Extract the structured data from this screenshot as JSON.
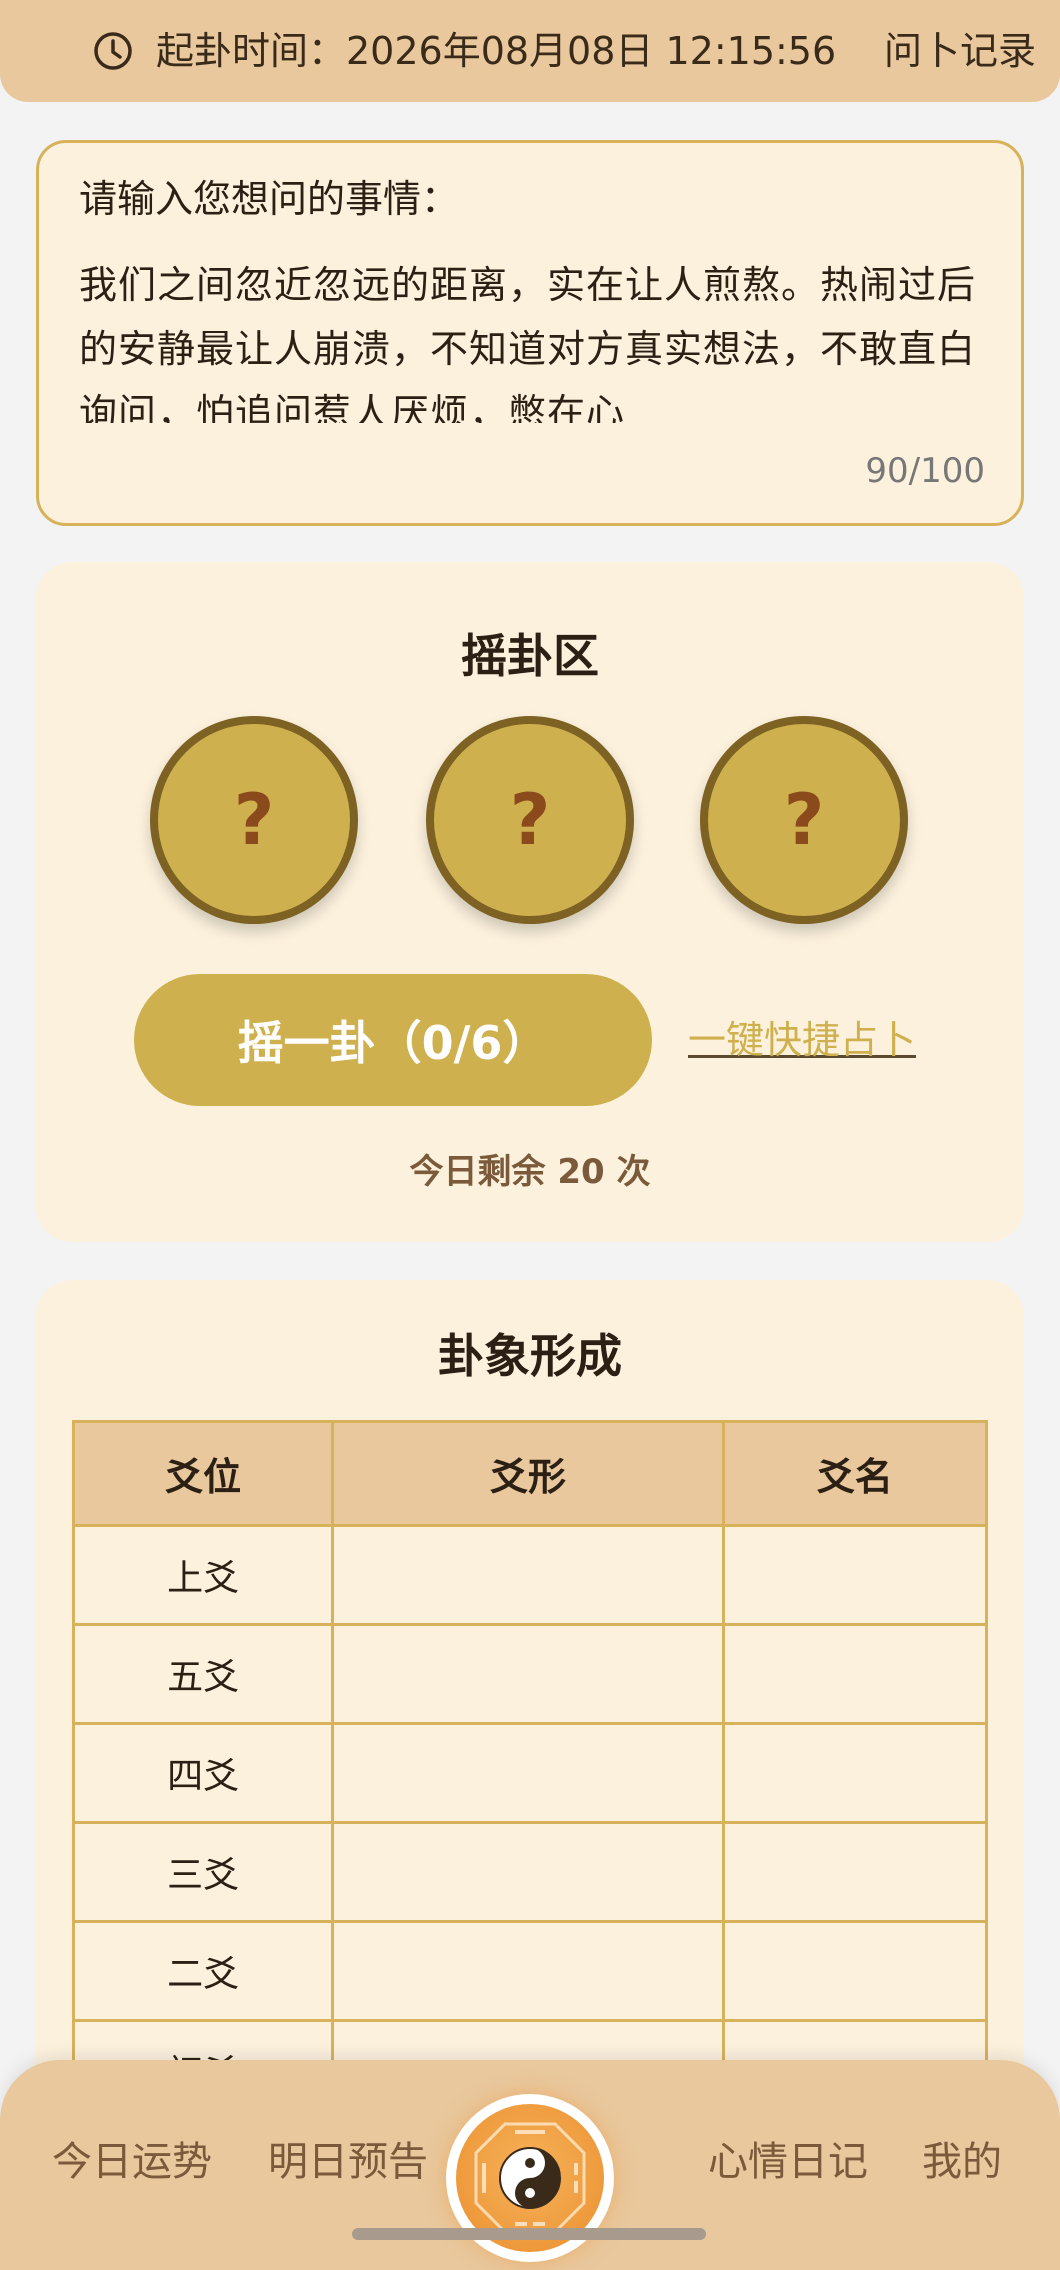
{
  "header": {
    "start_time": "起卦时间：2026年08月08日 12:15:56",
    "records": "问卜记录"
  },
  "question": {
    "label": "请输入您想问的事情：",
    "text": "我们之间忽近忽远的距离，实在让人煎熬。热闹过后的安静最让人崩溃，不知道对方真实想法，不敢直白询问，怕追问惹人厌烦，憋在心",
    "count": "90/100"
  },
  "shake": {
    "title": "摇卦区",
    "coins": [
      "?",
      "?",
      "?"
    ],
    "button": "摇一卦（0/6）",
    "quick": "一键快捷占卜",
    "remaining": "今日剩余 20 次"
  },
  "hexagram": {
    "title": "卦象形成",
    "headers": [
      "爻位",
      "爻形",
      "爻名"
    ],
    "rows": [
      "上爻",
      "五爻",
      "四爻",
      "三爻",
      "二爻",
      "初爻"
    ]
  },
  "nav": {
    "items": [
      "今日运势",
      "明日预告",
      "心情日记",
      "我的"
    ]
  },
  "colors": {
    "header_bg": "#e9c89d",
    "card_bg": "#fcf1dd",
    "gold": "#cfb04e",
    "accent": "#ea8f2e"
  }
}
